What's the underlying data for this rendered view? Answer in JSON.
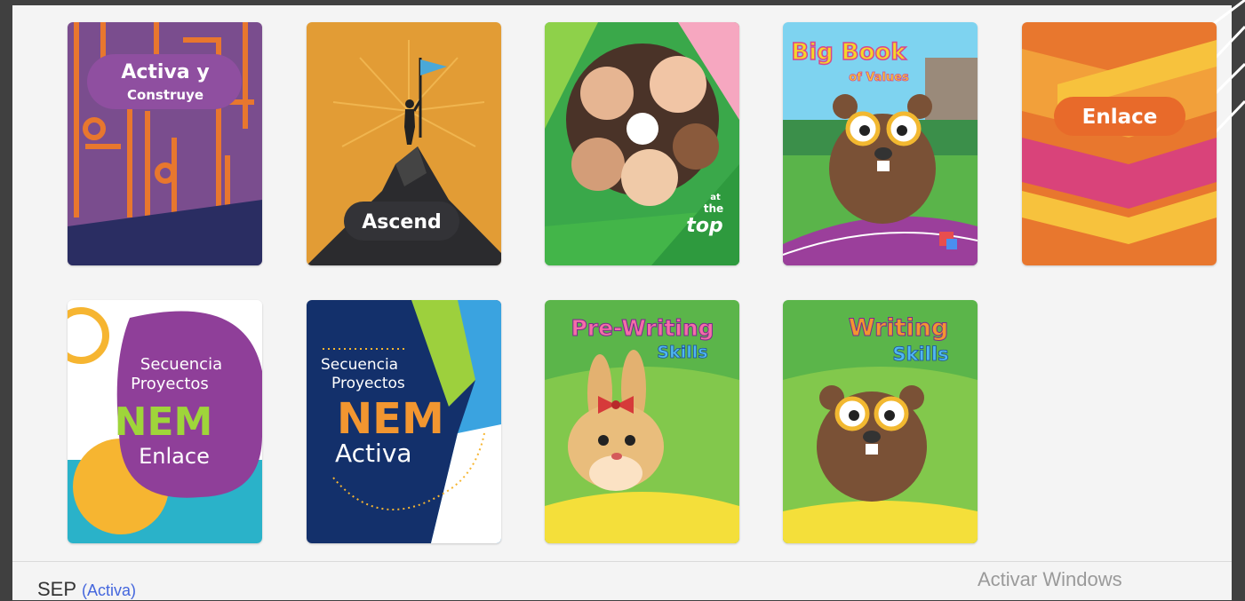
{
  "books": [
    {
      "title_line1": "Activa y",
      "title_line2": "Construye"
    },
    {
      "title": "Ascend"
    },
    {
      "logo_line1": "at",
      "logo_line2": "the",
      "logo_line3": "top"
    },
    {
      "title_line1": "Big Book",
      "title_line2": "of Values"
    },
    {
      "title": "Enlace"
    },
    {
      "line1": "Secuencia",
      "line2": "Proyectos",
      "line3": "NEM",
      "line4": "Enlace"
    },
    {
      "line1": "Secuencia",
      "line2": "Proyectos",
      "line3": "NEM",
      "line4": "Activa"
    },
    {
      "title_line1": "Pre-Writing",
      "title_line2": "Skills"
    },
    {
      "title_line1": "Writing",
      "title_line2": "Skills"
    }
  ],
  "footer": {
    "label": "SEP",
    "sublabel": "(Activa)"
  },
  "watermark": "Activar Windows"
}
